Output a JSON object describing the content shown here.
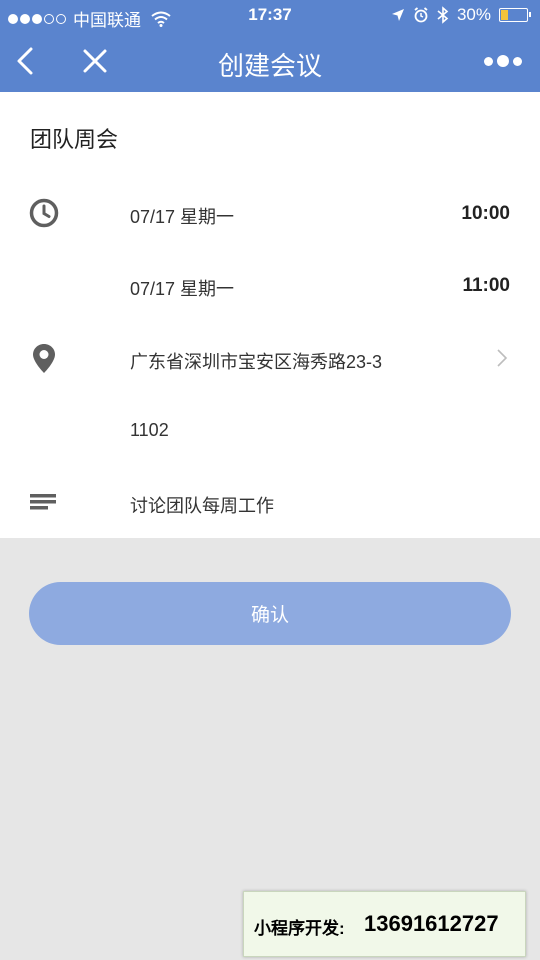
{
  "status_bar": {
    "carrier": "中国联通",
    "time": "17:37",
    "battery": "30%",
    "battery_level": 0.3,
    "battery_color": "#f3c33b"
  },
  "nav": {
    "title": "创建会议",
    "back_icon": "chevron-left-icon",
    "close_icon": "close-icon",
    "more_icon": "more-icon",
    "color": "#5a84ce"
  },
  "meeting": {
    "title": "团队周会",
    "start_date": "07/17 星期一",
    "start_time": "10:00",
    "end_date": "07/17 星期一",
    "end_time": "11:00",
    "address_line1": "广东省深圳市宝安区海秀路23-3",
    "address_line2": "1102",
    "description": "讨论团队每周工作"
  },
  "icons": {
    "time": "clock-icon",
    "location": "location-pin-icon",
    "description": "text-lines-icon",
    "address_more": "chevron-right-icon"
  },
  "confirm_label": "确认",
  "confirm_color": "#8eaae0",
  "promo": {
    "label": "小程序开发:",
    "phone": "13691612727"
  }
}
